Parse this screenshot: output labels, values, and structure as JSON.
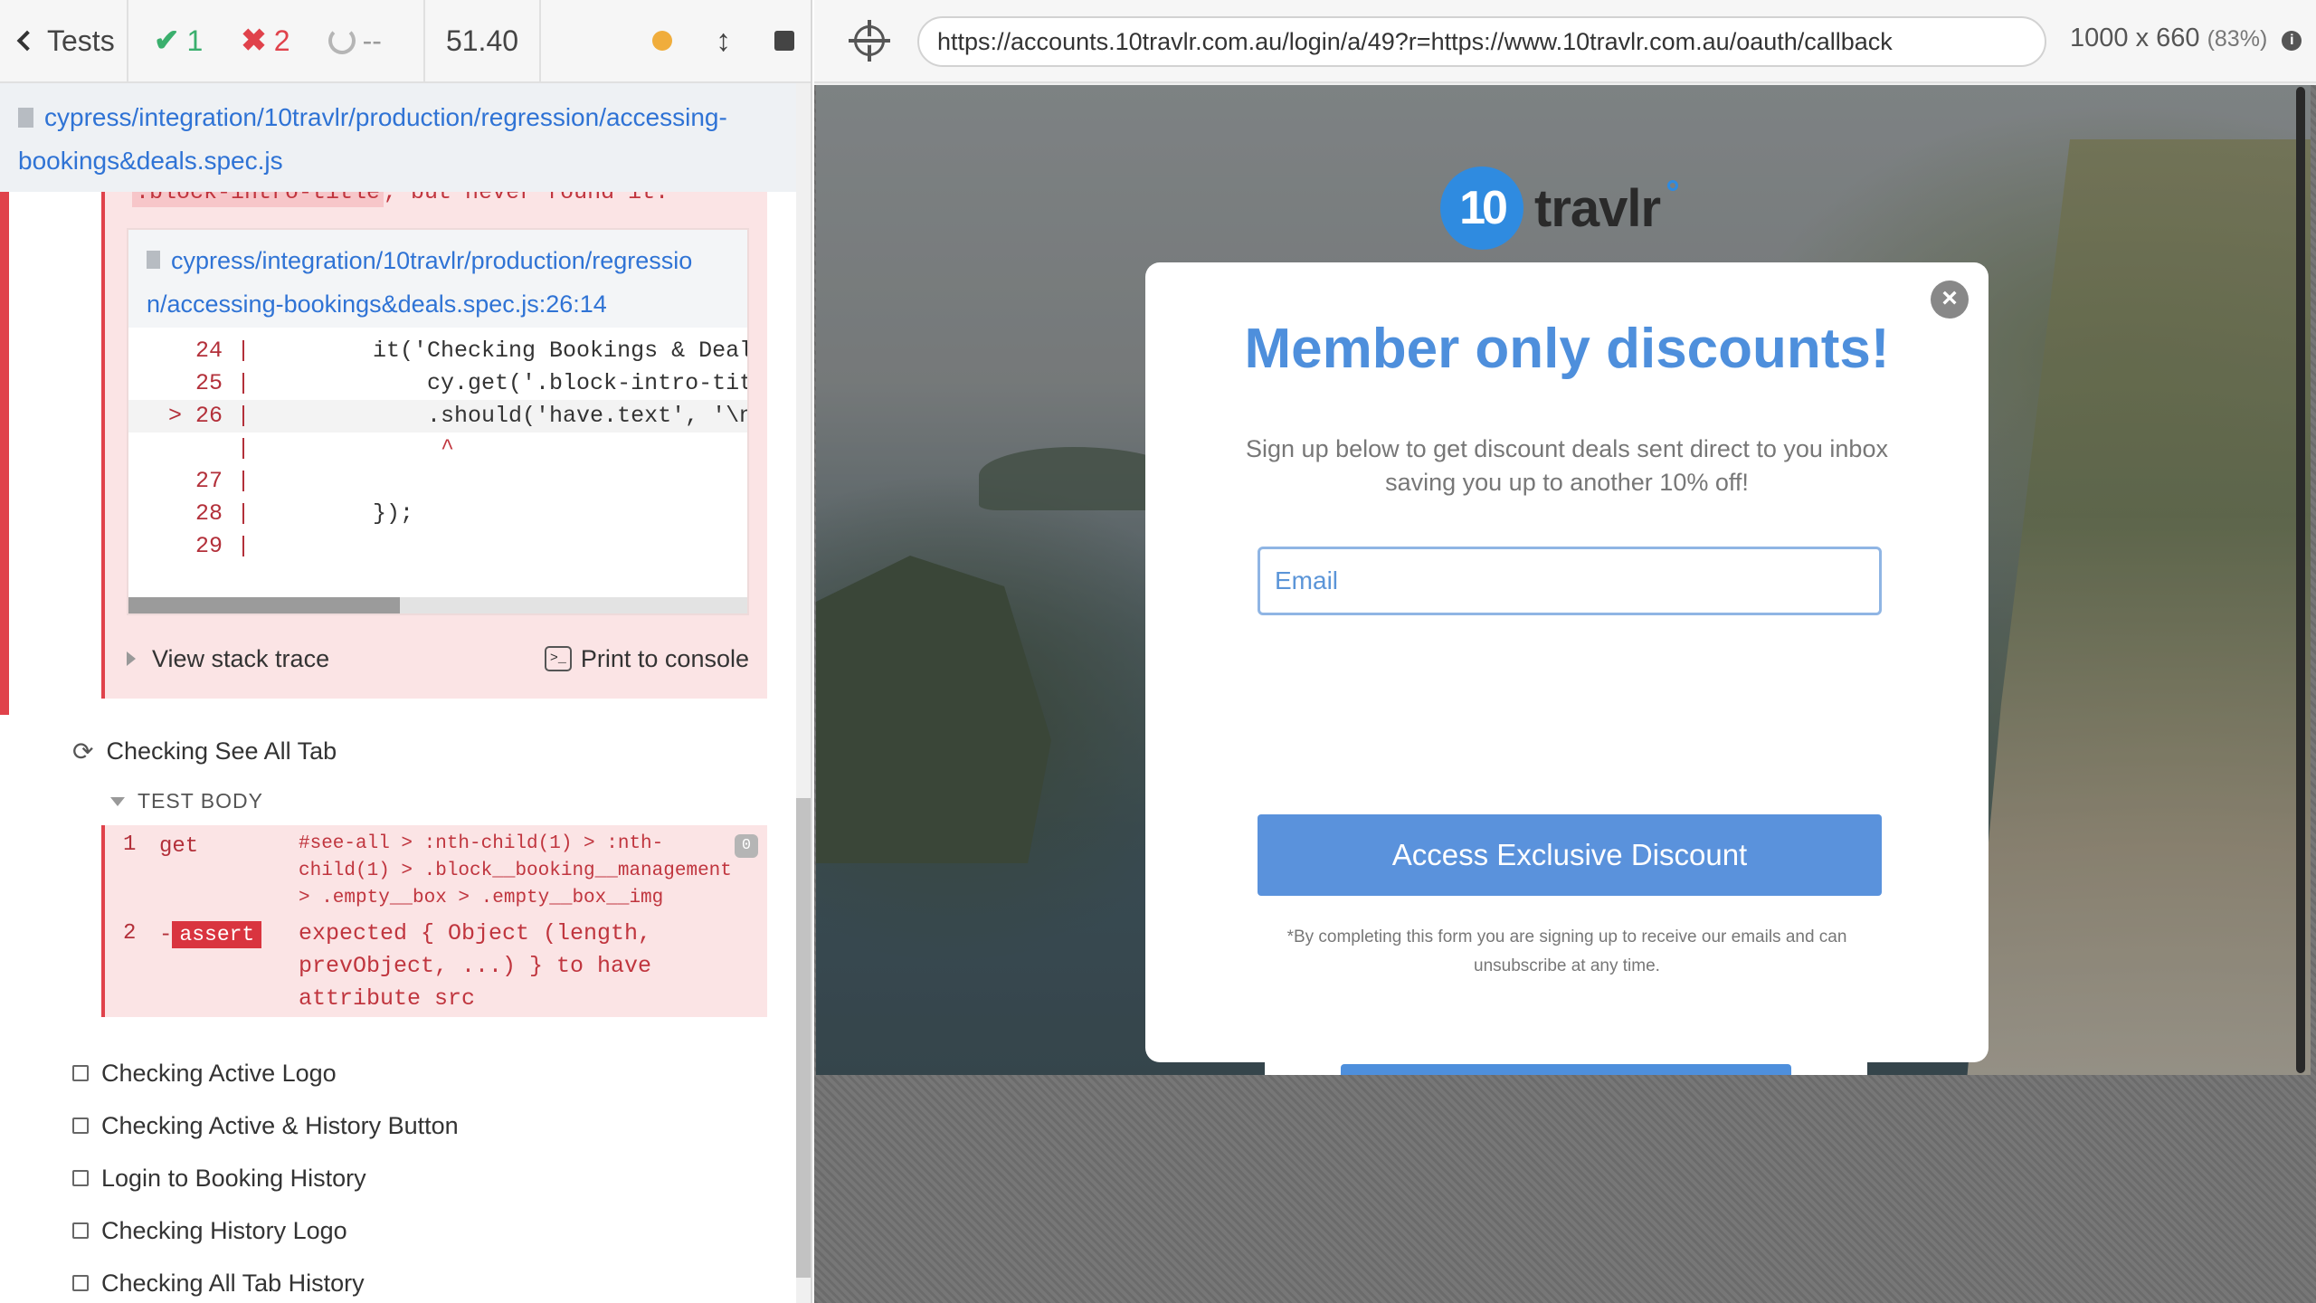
{
  "reporter": {
    "tests_label": "Tests",
    "passed": "1",
    "failed": "2",
    "pending": "--",
    "duration": "51.40",
    "spec_path": "cypress/integration/10travlr/production/regression/accessing-bookings&deals.spec.js",
    "error": {
      "message_tail_code": ".block-intro-title",
      "message_tail_text": ", but never found it.",
      "frame_path_line1": "cypress/integration/10travlr/production/regressio",
      "frame_path_line2": "n/accessing-bookings&deals.spec.js:26:14",
      "code_lines": [
        {
          "num": "24",
          "marker": " ",
          "code": "        it('Checking Bookings & Deals"
        },
        {
          "num": "25",
          "marker": " ",
          "code": "            cy.get('.block-intro-titl"
        },
        {
          "num": "26",
          "marker": ">",
          "code": "            .should('have.text', '\\n"
        },
        {
          "num": "",
          "marker": " ",
          "code": "             ^"
        },
        {
          "num": "27",
          "marker": " ",
          "code": ""
        },
        {
          "num": "28",
          "marker": " ",
          "code": "        });"
        },
        {
          "num": "29",
          "marker": " ",
          "code": ""
        }
      ],
      "view_stack_trace": "View stack trace",
      "print_to_console": "Print to console",
      "console_glyph": ">_"
    },
    "current_test": "Checking See All Tab",
    "test_body_label": "TEST BODY",
    "commands": [
      {
        "num": "1",
        "name": "get",
        "message": "#see-all > :nth-child(1) > :nth-child(1) > .block__booking__management > .empty__box > .empty__box__img",
        "count": "0"
      },
      {
        "num": "2",
        "prefix": "-",
        "name": "assert",
        "message": "expected { Object (length, prevObject, ...) } to have attribute src"
      }
    ],
    "pending_tests": [
      "Checking Active Logo",
      "Checking Active & History Button",
      "Login to Booking History",
      "Checking History Logo",
      "Checking All Tab History"
    ]
  },
  "aut": {
    "url": "https://accounts.10travlr.com.au/login/a/49?r=https://www.10travlr.com.au/oauth/callback",
    "viewport_size": "1000 x 660",
    "viewport_scale": "(83%)",
    "logo_number": "10",
    "logo_text": "travlr",
    "modal": {
      "title": "Member only discounts!",
      "subtitle": "Sign up below to get discount deals sent direct to you inbox saving you up to another 10% off!",
      "email_placeholder": "Email",
      "cta_label": "Access Exclusive Discount",
      "disclaimer": "*By completing this form you are signing up to receive our emails and can unsubscribe at any time.",
      "close_glyph": "×"
    }
  },
  "colors": {
    "fail": "#e0424b",
    "pass": "#3aaf6d",
    "accent_blue": "#4e8fdc",
    "link_blue": "#2f73d5"
  },
  "icons": [
    "chevron-left-icon",
    "check-icon",
    "x-icon",
    "spinner-icon",
    "status-dot-icon",
    "resize-icon",
    "stop-icon",
    "file-icon",
    "terminal-icon",
    "refresh-icon",
    "crosshair-icon",
    "info-icon",
    "close-icon"
  ]
}
